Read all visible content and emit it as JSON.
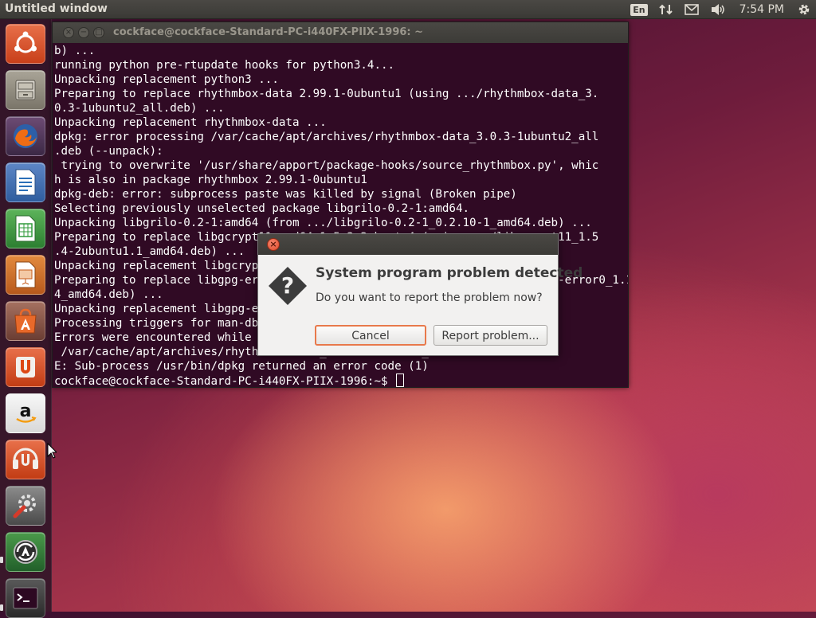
{
  "top_panel": {
    "title": "Untitled window",
    "lang": "En",
    "time": "7:54 PM"
  },
  "launcher": {
    "items": [
      {
        "name": "dash-home-icon",
        "color": "#dd4814"
      },
      {
        "name": "files-icon",
        "color": "#8a8477"
      },
      {
        "name": "firefox-icon",
        "color": "#e66000"
      },
      {
        "name": "writer-icon",
        "color": "#2a6fb8"
      },
      {
        "name": "calc-icon",
        "color": "#2f9a3a"
      },
      {
        "name": "impress-icon",
        "color": "#c45a1a"
      },
      {
        "name": "software-center-icon",
        "color": "#e8692a"
      },
      {
        "name": "ubuntu-one-icon",
        "color": "#dd4814"
      },
      {
        "name": "amazon-icon",
        "color": "#f2f2f2"
      },
      {
        "name": "ubuntu-one-music-icon",
        "color": "#dd4814"
      },
      {
        "name": "system-settings-icon",
        "color": "#6a6a6a"
      },
      {
        "name": "software-updater-icon",
        "color": "#3a7d3a"
      },
      {
        "name": "terminal-icon",
        "color": "#2d2d2d"
      }
    ]
  },
  "terminal": {
    "title": "cockface@cockface-Standard-PC-i440FX-PIIX-1996: ~",
    "lines": [
      "b) ...",
      "running python pre-rtupdate hooks for python3.4...",
      "Unpacking replacement python3 ...",
      "Preparing to replace rhythmbox-data 2.99.1-0ubuntu1 (using .../rhythmbox-data_3.",
      "0.3-1ubuntu2_all.deb) ...",
      "Unpacking replacement rhythmbox-data ...",
      "dpkg: error processing /var/cache/apt/archives/rhythmbox-data_3.0.3-1ubuntu2_all",
      ".deb (--unpack):",
      " trying to overwrite '/usr/share/apport/package-hooks/source_rhythmbox.py', whic",
      "h is also in package rhythmbox 2.99.1-0ubuntu1",
      "dpkg-deb: error: subprocess paste was killed by signal (Broken pipe)",
      "Selecting previously unselected package libgrilo-0.2-1:amd64.",
      "Unpacking libgrilo-0.2-1:amd64 (from .../libgrilo-0.2-1_0.2.10-1_amd64.deb) ...",
      "Preparing to replace libgcrypt11:amd64 1.5.3-2ubuntu4 (using .../libgcrypt11_1.5",
      ".4-2ubuntu1.1_amd64.deb) ...",
      "Unpacking replacement libgcrypt11:amd64 ...",
      "Preparing to replace libgpg-error0:amd64 1.12-0.2ubuntu1 (using .../libgpg-error0_1.13-",
      "4_amd64.deb) ...",
      "Unpacking replacement libgpg-error0:amd64 ...",
      "Processing triggers for man-db (2.6.7.1-1) ...",
      "Errors were encountered while processing:",
      " /var/cache/apt/archives/rhythmbox-data_3.0.3-1ubuntu2_all.deb",
      "E: Sub-process /usr/bin/dpkg returned an error code (1)"
    ],
    "prompt": "cockface@cockface-Standard-PC-i440FX-PIIX-1996:~$ "
  },
  "dialog": {
    "heading": "System program problem detected",
    "text": "Do you want to report the problem now?",
    "cancel_label": "Cancel",
    "report_label": "Report problem..."
  }
}
